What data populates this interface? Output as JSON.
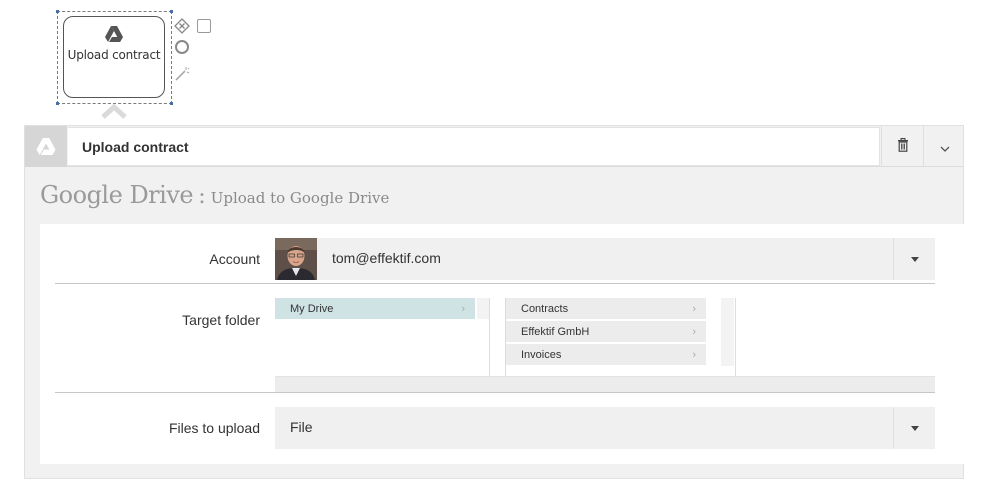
{
  "canvas": {
    "task_node": {
      "label": "Upload contract",
      "icon": "google-drive-icon"
    },
    "tools": [
      "exclusive-gateway-icon",
      "annotation-icon",
      "end-event-icon",
      "connect-wand-icon"
    ]
  },
  "panel": {
    "header": {
      "service_icon": "google-drive-icon",
      "activity_name": "Upload contract",
      "delete_icon": "trash-icon",
      "menu_icon": "chevron-down-icon"
    },
    "title": {
      "service": "Google Drive",
      "separator": ":",
      "action": "Upload to Google Drive"
    },
    "fields": {
      "account": {
        "label": "Account",
        "value": "tom@effektif.com"
      },
      "target_folder": {
        "label": "Target folder",
        "column1": [
          {
            "name": "My Drive",
            "selected": true
          }
        ],
        "column2": [
          {
            "name": "Contracts"
          },
          {
            "name": "Effektif GmbH"
          },
          {
            "name": "Invoices"
          }
        ]
      },
      "files_to_upload": {
        "label": "Files to upload",
        "value": "File"
      }
    }
  },
  "colors": {
    "panel_bg": "#f1f1f1",
    "selected_folder": "#cfe3e5",
    "title_gray": "#9a9a9a"
  }
}
